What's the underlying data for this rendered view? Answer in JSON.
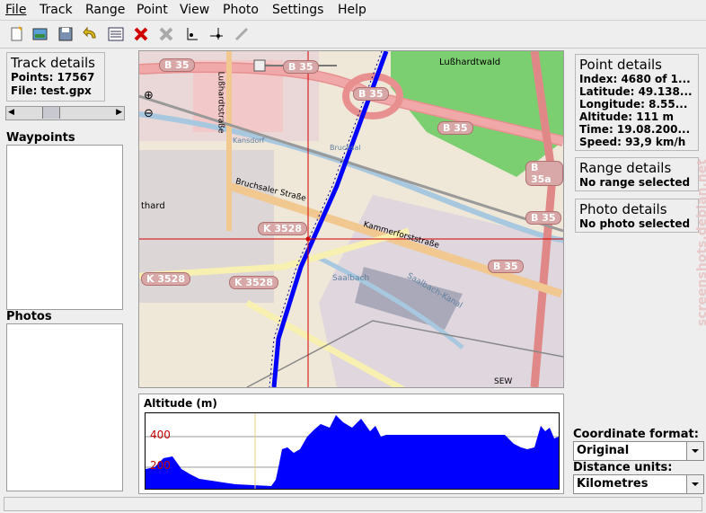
{
  "menu": [
    "File",
    "Track",
    "Range",
    "Point",
    "View",
    "Photo",
    "Settings",
    "Help"
  ],
  "track_details": {
    "title": "Track details",
    "points": "Points: 17567",
    "file": "File: test.gpx"
  },
  "waypoints_label": "Waypoints",
  "photos_label": "Photos",
  "point_details": {
    "title": "Point details",
    "index": "Index: 4680 of 1...",
    "latitude": "Latitude: 49.138...",
    "longitude": "Longitude: 8.55...",
    "altitude": "Altitude: 111 m",
    "time": "Time: 19.08.200...",
    "speed": "Speed: 93,9 km/h"
  },
  "range_details": {
    "title": "Range details",
    "value": "No range selected"
  },
  "photo_details": {
    "title": "Photo details",
    "value": "No photo selected"
  },
  "coordinate_format": {
    "label": "Coordinate format:",
    "value": "Original"
  },
  "distance_units": {
    "label": "Distance units:",
    "value": "Kilometres"
  },
  "altitude_chart": {
    "title": "Altitude (m)",
    "tick_400": "400",
    "tick_200": "200"
  },
  "map_labels": {
    "b35": "B 35",
    "b35a": "B 35a",
    "k3528": "K 3528",
    "street1": "Bruchsaler Straße",
    "street2": "Kammerforststraße",
    "street3": "Lußhardtstraße",
    "wald": "Lußhardtwald",
    "thard": "thard",
    "saalbach": "Saalbach",
    "kanal": "Saalbach-Kanal",
    "sew": "SEW",
    "kansdorf": "Kansdorf",
    "bruchsal": "Bruchsal"
  },
  "watermark": "screenshots.debian.net"
}
